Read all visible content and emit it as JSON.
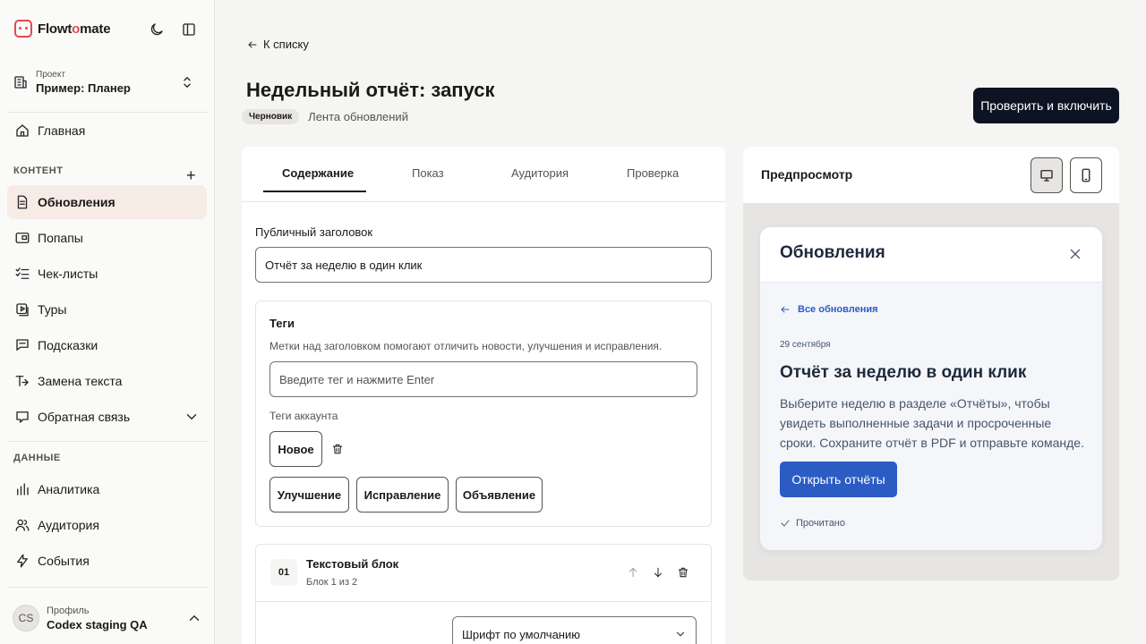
{
  "brand": {
    "name_prefix": "Flowt",
    "name_accent": "o",
    "name_suffix": "mate"
  },
  "project": {
    "label": "Проект",
    "name": "Пример: Планер"
  },
  "nav": {
    "home": "Главная",
    "content_section": "КОНТЕНТ",
    "content_items": [
      "Обновления",
      "Попапы",
      "Чек-листы",
      "Туры",
      "Подсказки",
      "Замена текста",
      "Обратная связь"
    ],
    "data_section": "ДАННЫЕ",
    "data_items": [
      "Аналитика",
      "Аудитория",
      "События"
    ]
  },
  "profile": {
    "initials": "CS",
    "label": "Профиль",
    "name": "Codex staging QA"
  },
  "header": {
    "back": "К списку",
    "title": "Недельный отчёт: запуск",
    "badge": "Черновик",
    "type": "Лента обновлений",
    "primary_button": "Проверить и включить"
  },
  "tabs": [
    "Содержание",
    "Показ",
    "Аудитория",
    "Проверка"
  ],
  "form": {
    "public_title_label": "Публичный заголовок",
    "public_title_value": "Отчёт за неделю в один клик",
    "tags_title": "Теги",
    "tags_hint": "Метки над заголовком помогают отличить новости, улучшения и исправления.",
    "tags_placeholder": "Введите тег и нажмите Enter",
    "account_tags_label": "Теги аккаунта",
    "account_tags": [
      "Новое",
      "Улучшение",
      "Исправление",
      "Объявление"
    ],
    "block": {
      "number": "01",
      "title": "Текстовый блок",
      "subtitle": "Блок 1 из 2",
      "font_select": "Шрифт по умолчанию"
    }
  },
  "preview": {
    "title": "Предпросмотр",
    "widget": {
      "title": "Обновления",
      "back": "Все обновления",
      "date": "29 сентября",
      "heading": "Отчёт за неделю в один клик",
      "body": "Выберите неделю в разделе «Отчёты», чтобы увидеть выполненные задачи и просроченные сроки. Сохраните отчёт в PDF и отправьте команде.",
      "button": "Открыть отчёты",
      "read_status": "Прочитано"
    }
  },
  "colors": {
    "accent": "#e5484d",
    "primary_button": "#0c1322",
    "widget_accent": "#2b5cc4",
    "active_nav": "#f7ebe6"
  }
}
